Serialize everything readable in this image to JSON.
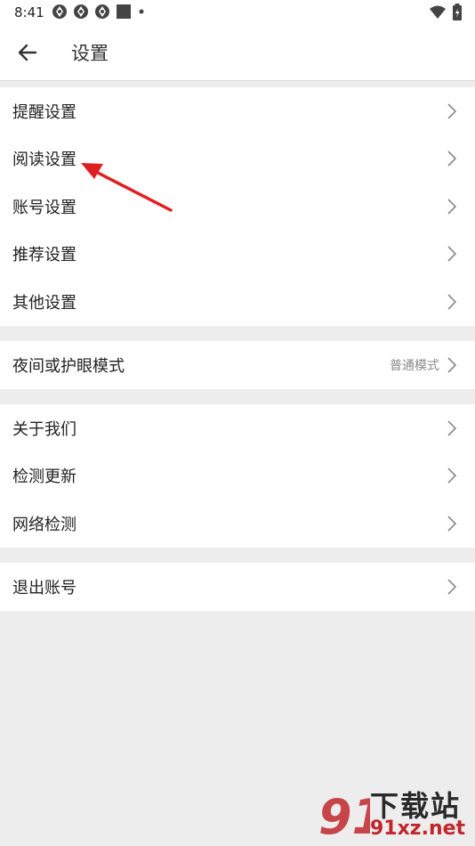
{
  "status_bar": {
    "time": "8:41",
    "left_icons": [
      "app-notification-icon",
      "app-notification-icon",
      "app-notification-icon",
      "square-icon",
      "dot-icon"
    ],
    "right_icons": [
      "wifi-icon",
      "battery-icon"
    ]
  },
  "header": {
    "title": "设置",
    "back_icon": "arrow-left-icon"
  },
  "groups": [
    {
      "items": [
        {
          "label": "提醒设置"
        },
        {
          "label": "阅读设置"
        },
        {
          "label": "账号设置"
        },
        {
          "label": "推荐设置"
        },
        {
          "label": "其他设置"
        }
      ]
    },
    {
      "items": [
        {
          "label": "夜间或护眼模式",
          "value": "普通模式"
        }
      ]
    },
    {
      "items": [
        {
          "label": "关于我们"
        },
        {
          "label": "检测更新"
        },
        {
          "label": "网络检测"
        }
      ]
    },
    {
      "items": [
        {
          "label": "退出账号"
        }
      ]
    }
  ],
  "annotation": {
    "color": "#e02020",
    "points_to": "阅读设置"
  },
  "watermark": {
    "logo_text": "91",
    "name": "下载站",
    "domain": "91xz.net",
    "accent": "#c0262c"
  }
}
